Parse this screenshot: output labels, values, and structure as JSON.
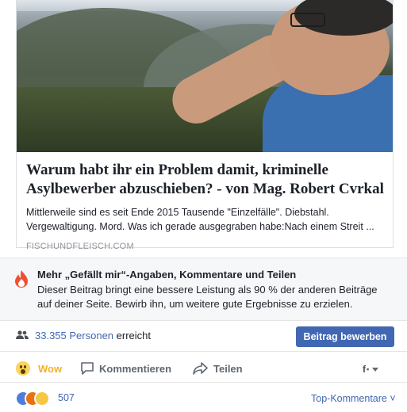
{
  "card": {
    "title": "Warum habt ihr ein Problem damit, kriminelle Asylbewerber abzuschieben? - von Mag. Robert Cvrkal",
    "description": "Mittlerweile sind es seit Ende 2015 Tausende \"Einzelfälle\". Diebstahl. Vergewaltigung. Mord. Was ich gerade ausgegraben habe:Nach einem Streit ...",
    "domain": "FISCHUNDFLEISCH.COM"
  },
  "insight": {
    "icon": "flame-icon",
    "title": "Mehr „Gefällt mir“-Angaben, Kommentare und Teilen",
    "text": "Dieser Beitrag bringt eine bessere Leistung als 90 % der anderen Beiträge auf deiner Seite. Bewirb ihn, um weitere gute Ergebnisse zu erzielen."
  },
  "reach": {
    "count": "33.355 Personen",
    "suffix": " erreicht",
    "boost_label": "Beitrag bewerben"
  },
  "actions": {
    "wow": "Wow",
    "comment": "Kommentieren",
    "share": "Teilen",
    "audience": "f"
  },
  "reactions": {
    "count": "507",
    "sort_label": "Top-Kommentare ˅"
  },
  "colors": {
    "accent": "#4267b2",
    "wow": "#f7b125"
  }
}
